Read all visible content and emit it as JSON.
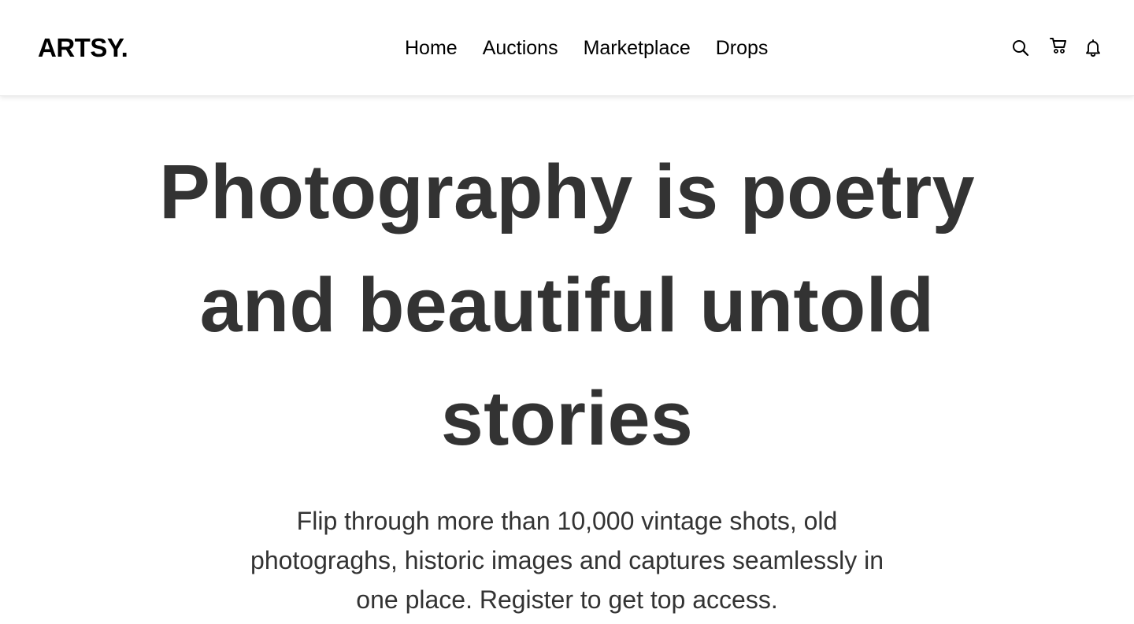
{
  "brand": {
    "logo_text": "ARTSY."
  },
  "nav": {
    "items": [
      {
        "label": "Home"
      },
      {
        "label": "Auctions"
      },
      {
        "label": "Marketplace"
      },
      {
        "label": "Drops"
      }
    ]
  },
  "header_icons": [
    {
      "name": "search-icon"
    },
    {
      "name": "cart-icon"
    },
    {
      "name": "bell-icon"
    }
  ],
  "hero": {
    "title": "Photography is poetry and beautiful untold stories",
    "subtitle": "Flip through more than 10,000 vintage shots, old photograghs, historic images and captures seamlessly in one place. Register to get top access."
  },
  "colors": {
    "text_dark": "#333333",
    "nav_text": "#000000",
    "background": "#ffffff"
  }
}
